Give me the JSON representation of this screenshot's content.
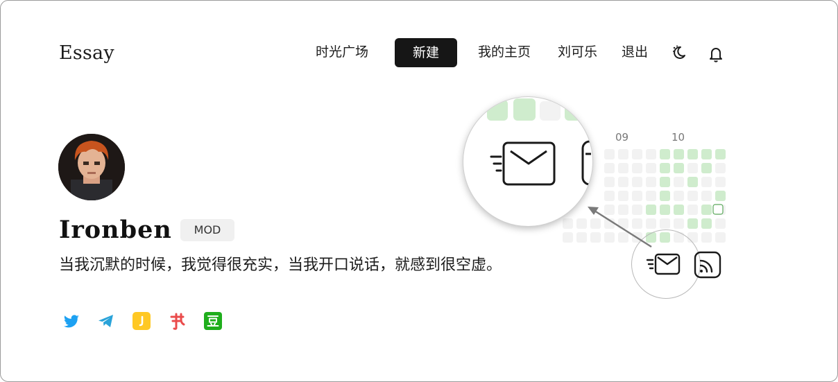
{
  "brand": "Essay",
  "nav": {
    "square": "时光广场",
    "new": "新建",
    "home": "我的主页",
    "user": "刘可乐",
    "logout": "退出"
  },
  "icons": {
    "theme": "moon-icon",
    "notifications": "bell-icon",
    "email": "email-fast-icon",
    "rss": "rss-icon"
  },
  "profile": {
    "name": "Ironben",
    "badge": "MOD",
    "bio": "当我沉默的时候，我觉得很充实，当我开口说话，就感到很空虚。"
  },
  "social": [
    "twitter-icon",
    "telegram-icon",
    "jike-icon",
    "xiaohongshu-icon",
    "douban-icon"
  ],
  "heatmap": {
    "months": [
      "09",
      "10"
    ],
    "empty_color": "#f2f2f2",
    "active_color": "#cfeccd",
    "strong_color": "#b9e3b5"
  },
  "colors": {
    "twitter": "#1da1f2",
    "telegram": "#2aa3d9",
    "jike": "#ffc824",
    "xiaohongshu": "#ea4b4b",
    "douban": "#1fae1c"
  }
}
